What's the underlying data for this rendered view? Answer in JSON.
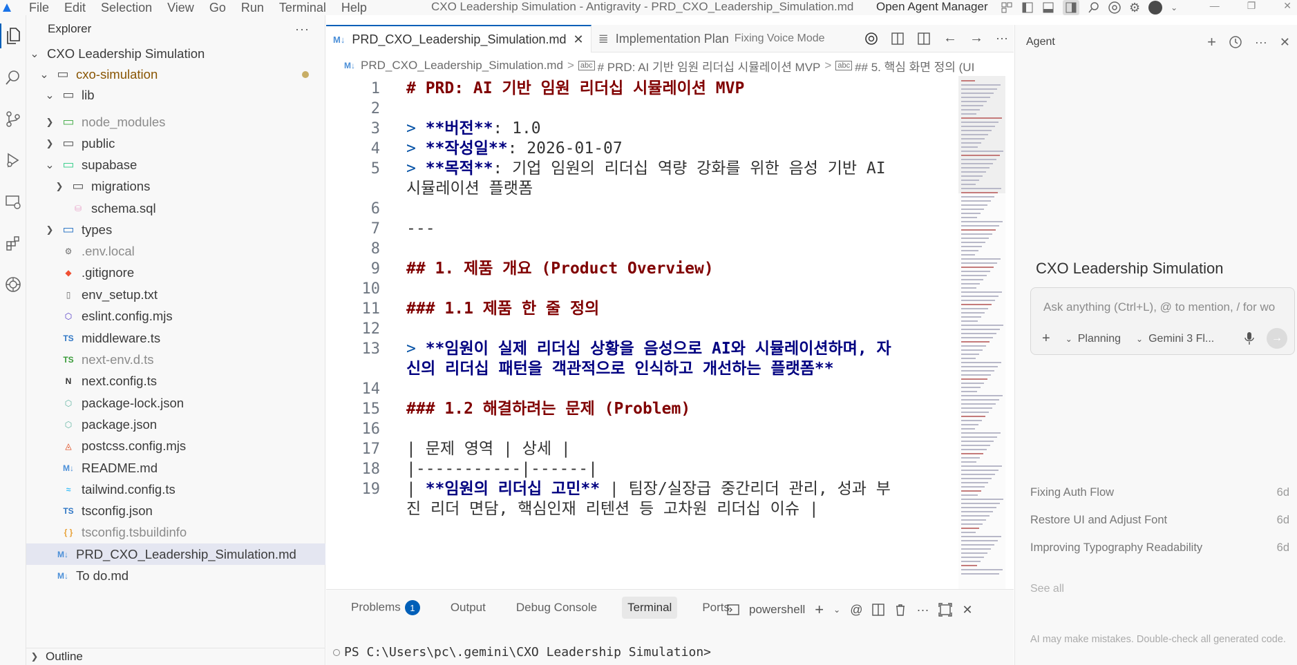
{
  "titlebar": {
    "menu": [
      "File",
      "Edit",
      "Selection",
      "View",
      "Go",
      "Run",
      "Terminal",
      "Help"
    ],
    "window_title": "CXO Leadership Simulation - Antigravity - PRD_CXO_Leadership_Simulation.md",
    "open_agent_manager": "Open Agent Manager"
  },
  "sidebar": {
    "title": "Explorer",
    "more": "···",
    "outline": "Outline",
    "tree": [
      {
        "label": "CXO Leadership Simulation",
        "type": "root",
        "indent": 0,
        "chev": "open"
      },
      {
        "label": "cxo-simulation",
        "type": "folder",
        "indent": 1,
        "chev": "open",
        "modified": true
      },
      {
        "label": "lib",
        "type": "folder",
        "indent": 2,
        "chev": "open"
      },
      {
        "label": "node_modules",
        "type": "folder-node",
        "indent": 2,
        "chev": "closed",
        "dim": true
      },
      {
        "label": "public",
        "type": "folder",
        "indent": 2,
        "chev": "closed"
      },
      {
        "label": "supabase",
        "type": "folder-db",
        "indent": 2,
        "chev": "open"
      },
      {
        "label": "migrations",
        "type": "folder",
        "indent": 3,
        "chev": "closed"
      },
      {
        "label": "schema.sql",
        "type": "db",
        "indent": 3
      },
      {
        "label": "types",
        "type": "folder-ts",
        "indent": 2,
        "chev": "closed"
      },
      {
        "label": ".env.local",
        "type": "gear",
        "indent": 2,
        "dim": true
      },
      {
        "label": ".gitignore",
        "type": "git",
        "indent": 2
      },
      {
        "label": "env_setup.txt",
        "type": "file",
        "indent": 2
      },
      {
        "label": "eslint.config.mjs",
        "type": "eslint",
        "indent": 2
      },
      {
        "label": "middleware.ts",
        "type": "ts",
        "indent": 2
      },
      {
        "label": "next-env.d.ts",
        "type": "ts-green",
        "indent": 2,
        "dim": true
      },
      {
        "label": "next.config.ts",
        "type": "next",
        "indent": 2
      },
      {
        "label": "package-lock.json",
        "type": "node",
        "indent": 2
      },
      {
        "label": "package.json",
        "type": "node",
        "indent": 2
      },
      {
        "label": "postcss.config.mjs",
        "type": "postcss",
        "indent": 2
      },
      {
        "label": "README.md",
        "type": "md",
        "indent": 2
      },
      {
        "label": "tailwind.config.ts",
        "type": "tailwind",
        "indent": 2
      },
      {
        "label": "tsconfig.json",
        "type": "tsconfig",
        "indent": 2
      },
      {
        "label": "tsconfig.tsbuildinfo",
        "type": "json",
        "indent": 2,
        "dim": true
      },
      {
        "label": "PRD_CXO_Leadership_Simulation.md",
        "type": "md",
        "indent": 1,
        "selected": true
      },
      {
        "label": "To do.md",
        "type": "md",
        "indent": 1
      }
    ]
  },
  "tabs": [
    {
      "label": "PRD_CXO_Leadership_Simulation.md",
      "active": true,
      "icon": "M↓"
    },
    {
      "label": "Implementation Plan",
      "sub": "Fixing Voice Mode",
      "active": false,
      "icon": "≣"
    }
  ],
  "breadcrumb": [
    "PRD_CXO_Leadership_Simulation.md",
    "# PRD: AI 기반 임원 리더십 시뮬레이션 MVP",
    "## 5. 핵심 화면 정의 (UI"
  ],
  "editor": {
    "lines": [
      {
        "n": "1",
        "segs": [
          [
            "h",
            "# PRD: AI 기반 임원 리더십 시뮬레이션 MVP"
          ]
        ]
      },
      {
        "n": "2",
        "segs": []
      },
      {
        "n": "3",
        "segs": [
          [
            "q",
            "> "
          ],
          [
            "b",
            "**버전**"
          ],
          [
            "t",
            ": 1.0"
          ]
        ]
      },
      {
        "n": "4",
        "segs": [
          [
            "q",
            "> "
          ],
          [
            "b",
            "**작성일**"
          ],
          [
            "t",
            ": 2026-01-07"
          ]
        ]
      },
      {
        "n": "5",
        "segs": [
          [
            "q",
            "> "
          ],
          [
            "b",
            "**목적**"
          ],
          [
            "t",
            ": 기업 임원의 리더십 역량 강화를 위한 음성 기반 AI"
          ]
        ]
      },
      {
        "n": "",
        "segs": [
          [
            "t",
            "시뮬레이션 플랫폼"
          ]
        ]
      },
      {
        "n": "6",
        "segs": []
      },
      {
        "n": "7",
        "segs": [
          [
            "t",
            "---"
          ]
        ]
      },
      {
        "n": "8",
        "segs": []
      },
      {
        "n": "9",
        "segs": [
          [
            "h",
            "## 1. 제품 개요 (Product Overview)"
          ]
        ]
      },
      {
        "n": "10",
        "segs": []
      },
      {
        "n": "11",
        "segs": [
          [
            "h",
            "### 1.1 제품 한 줄 정의"
          ]
        ]
      },
      {
        "n": "12",
        "segs": []
      },
      {
        "n": "13",
        "segs": [
          [
            "q",
            "> "
          ],
          [
            "b",
            "**임원이 실제 리더십 상황을 음성으로 AI와 시뮬레이션하며, 자"
          ]
        ]
      },
      {
        "n": "",
        "segs": [
          [
            "b",
            "신의 리더십 패턴을 객관적으로 인식하고 개선하는 플랫폼**"
          ]
        ]
      },
      {
        "n": "14",
        "segs": []
      },
      {
        "n": "15",
        "segs": [
          [
            "h",
            "### 1.2 해결하려는 문제 (Problem)"
          ]
        ]
      },
      {
        "n": "16",
        "segs": []
      },
      {
        "n": "17",
        "segs": [
          [
            "t",
            "| 문제 영역 | 상세 |"
          ]
        ]
      },
      {
        "n": "18",
        "segs": [
          [
            "t",
            "|-----------|------|"
          ]
        ]
      },
      {
        "n": "19",
        "segs": [
          [
            "t",
            "| "
          ],
          [
            "b",
            "**임원의 리더십 고민**"
          ],
          [
            "t",
            " | 팀장/실장급 중간리더 관리, 성과 부"
          ]
        ]
      },
      {
        "n": "",
        "segs": [
          [
            "t",
            "진 리더 면담, 핵심인재 리텐션 등 고차원 리더십 이슈 |"
          ]
        ]
      }
    ]
  },
  "panel": {
    "tabs": [
      {
        "label": "Problems",
        "badge": "1"
      },
      {
        "label": "Output"
      },
      {
        "label": "Debug Console"
      },
      {
        "label": "Terminal",
        "active": true
      },
      {
        "label": "Ports"
      }
    ],
    "shell": "powershell",
    "prompt": "PS C:\\Users\\pc\\.gemini\\CXO Leadership Simulation>"
  },
  "agent": {
    "title": "Agent",
    "project_title": "CXO Leadership Simulation",
    "input_placeholder": "Ask anything (Ctrl+L), @ to mention, / for wo",
    "mode": "Planning",
    "model": "Gemini 3 Fl...",
    "conversations": [
      {
        "title": "Fixing Auth Flow",
        "age": "6d"
      },
      {
        "title": "Restore UI and Adjust Font",
        "age": "6d"
      },
      {
        "title": "Improving Typography Readability",
        "age": "6d"
      }
    ],
    "see_all": "See all",
    "disclaimer": "AI may make mistakes. Double-check all generated code."
  },
  "colors": {
    "accent": "#005fb8",
    "heading": "#800000",
    "quote": "#0451a5",
    "bold": "#000080",
    "modified": "#895503"
  }
}
